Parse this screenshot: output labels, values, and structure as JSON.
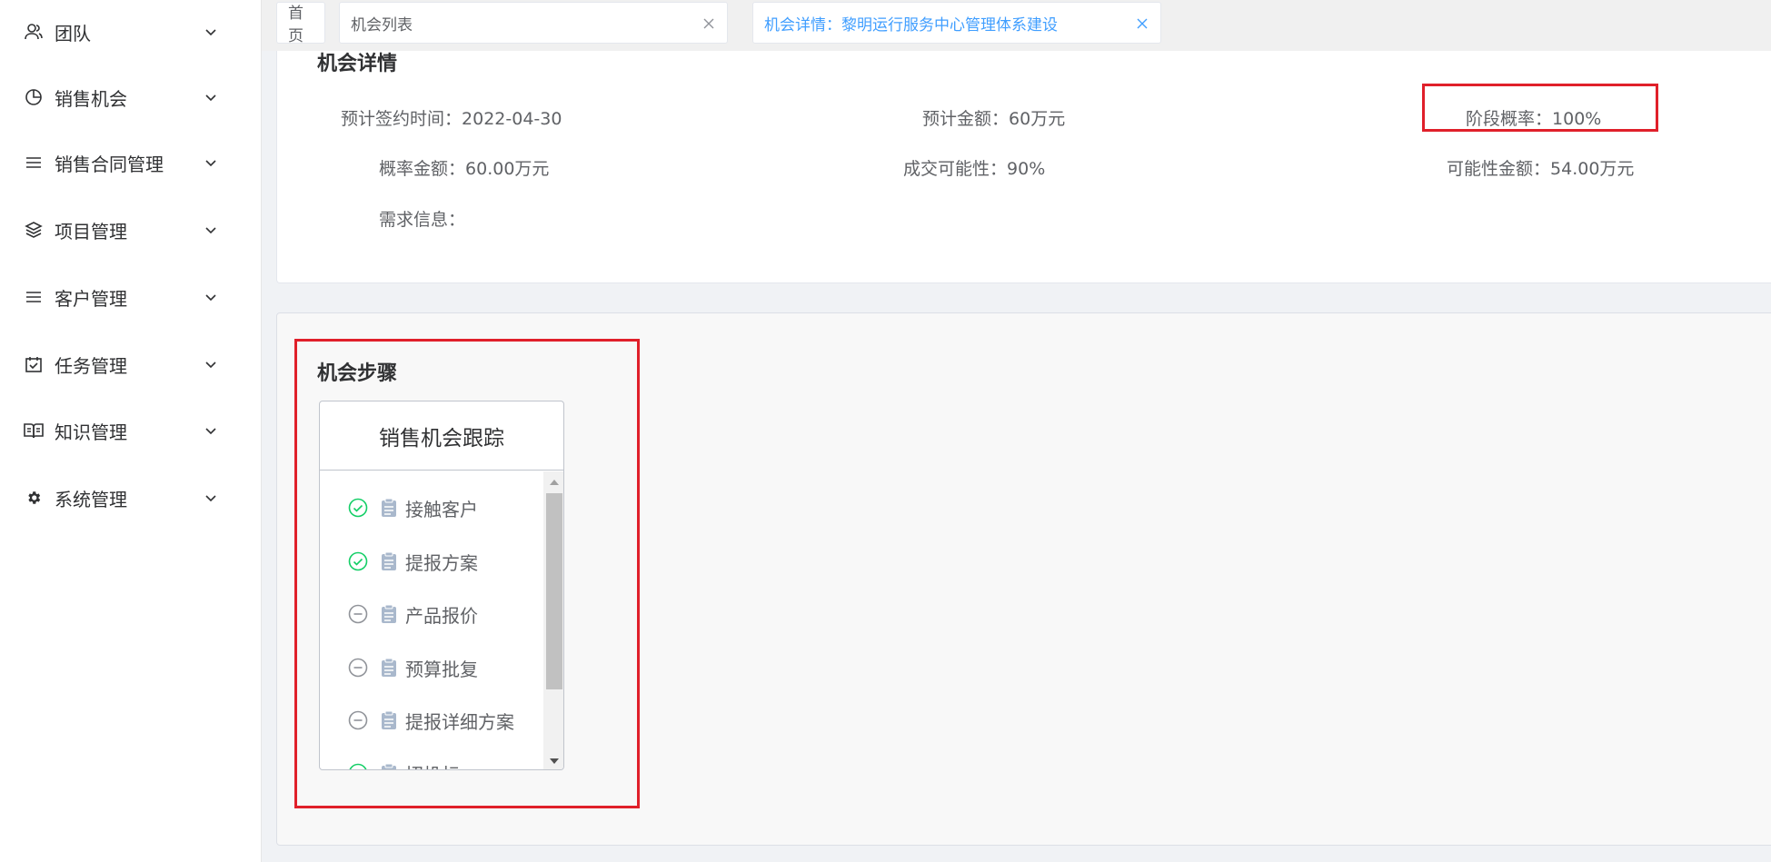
{
  "sidebar": {
    "items": [
      {
        "label": "团队",
        "icon": "team-icon"
      },
      {
        "label": "销售机会",
        "icon": "pie-chart-icon"
      },
      {
        "label": "销售合同管理",
        "icon": "list-icon"
      },
      {
        "label": "项目管理",
        "icon": "layers-icon"
      },
      {
        "label": "客户管理",
        "icon": "list-icon"
      },
      {
        "label": "任务管理",
        "icon": "calendar-check-icon"
      },
      {
        "label": "知识管理",
        "icon": "book-icon"
      },
      {
        "label": "系统管理",
        "icon": "gear-icon"
      }
    ]
  },
  "tabs": [
    {
      "label": "首页"
    },
    {
      "label": "机会列表"
    },
    {
      "label": "机会详情：黎明运行服务中心管理体系建设",
      "active": true
    }
  ],
  "detail": {
    "title": "机会详情",
    "fields": {
      "sign_date_label": "预计签约时间：",
      "sign_date_value": "2022-04-30",
      "amount_label": "预计金额：",
      "amount_value": "60万元",
      "stage_prob_label": "阶段概率：",
      "stage_prob_value": "100%",
      "prob_amount_label": "概率金额：",
      "prob_amount_value": "60.00万元",
      "deal_possibility_label": "成交可能性：",
      "deal_possibility_value": "90%",
      "possible_amount_label": "可能性金额：",
      "possible_amount_value": "54.00万元",
      "requirement_label": "需求信息：",
      "requirement_value": ""
    }
  },
  "steps": {
    "title": "机会步骤",
    "panel_title": "销售机会跟踪",
    "items": [
      {
        "label": "接触客户",
        "status": "done"
      },
      {
        "label": "提报方案",
        "status": "done"
      },
      {
        "label": "产品报价",
        "status": "pending"
      },
      {
        "label": "预算批复",
        "status": "pending"
      },
      {
        "label": "提报详细方案",
        "status": "pending"
      },
      {
        "label": "招投标",
        "status": "done"
      }
    ]
  },
  "colors": {
    "accent": "#409eff",
    "done": "#13ce66",
    "pending": "#909399",
    "highlight": "#e0202a"
  }
}
